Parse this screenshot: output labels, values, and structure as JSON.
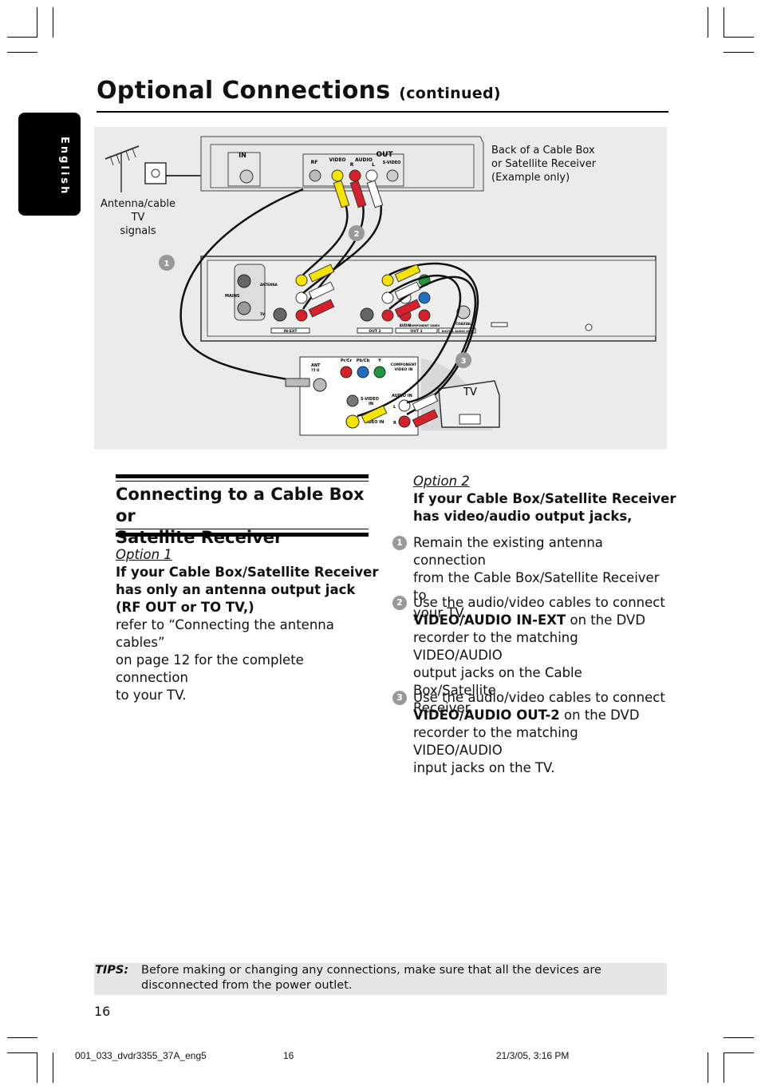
{
  "header": {
    "title": "Optional Connections",
    "title_suffix": "(continued)",
    "language_tab": "English"
  },
  "diagram": {
    "cable_box_label": [
      "Back of a Cable Box",
      "or Satellite Receiver",
      "(Example only)"
    ],
    "antenna_label": [
      "Antenna/cable TV",
      "signals"
    ],
    "cable_box_jacks": {
      "in": "IN",
      "out": "OUT",
      "rf": "RF",
      "video": "VIDEO",
      "audio": "AUDIO",
      "r": "R",
      "l": "L",
      "svideo": "S-VIDEO"
    },
    "recorder_labels": {
      "mains": "MAINS",
      "antenna": "ANTENNA",
      "tv": "TV",
      "in_ext": "IN-EXT",
      "out2": "OUT 2",
      "out1": "OUT 1",
      "audio": "AUDIO",
      "component": "COMPONENT VIDEO",
      "coaxial": "COAXIAL",
      "digital": "DIGITAL AUDIO OUT"
    },
    "tv_jacks": {
      "ant": "ANT",
      "ant_sub": "75 Ω",
      "pr": "Pr/Cr",
      "pb": "Pb/Cb",
      "y": "Y",
      "component": "COMPONENT",
      "component2": "VIDEO IN",
      "svideo": "S-VIDEO",
      "svideo2": "IN",
      "audio_in": "AUDIO IN",
      "l": "L",
      "r": "R",
      "video_in": "VIDEO IN"
    },
    "tv_label": "TV",
    "step_markers": [
      "1",
      "2",
      "3"
    ],
    "colors": {
      "video": "#f5e400",
      "audio_r": "#d8202a",
      "audio_l": "#ffffff",
      "y": "#1e9a3c",
      "pb": "#1f6fc0",
      "pr": "#d8202a"
    }
  },
  "section": {
    "title_line1": "Connecting to a Cable Box or",
    "title_line2": "Satellite Receiver",
    "option1": {
      "label": "Option 1",
      "heading": [
        "If your Cable Box/Satellite Receiver",
        "has only an antenna output jack",
        "(RF OUT or TO TV,)"
      ],
      "body": [
        "refer to “Connecting the antenna cables”",
        "on page 12 for the complete connection",
        "to your TV."
      ]
    },
    "option2": {
      "label": "Option 2",
      "heading": [
        "If your Cable Box/Satellite Receiver",
        "has video/audio output jacks,"
      ]
    },
    "steps": [
      {
        "num": "1",
        "lines": [
          "Remain the existing antenna connection",
          "from the Cable Box/Satellite Receiver to",
          "your TV."
        ]
      },
      {
        "num": "2",
        "pre": "Use the audio/video cables to connect",
        "bold": "VIDEO/AUDIO IN-EXT",
        "post": " on the DVD",
        "lines": [
          "recorder to the matching VIDEO/AUDIO",
          "output jacks on the Cable Box/Satellite",
          "Receiver."
        ]
      },
      {
        "num": "3",
        "pre": "Use the audio/video cables to connect",
        "bold": "VIDEO/AUDIO OUT-2",
        "post": " on the DVD",
        "lines": [
          "recorder to the matching VIDEO/AUDIO",
          "input jacks on the TV."
        ]
      }
    ]
  },
  "tips": {
    "label": "TIPS:",
    "text": "Before making or changing any connections, make sure that all the devices are disconnected from the power outlet."
  },
  "page_number": "16",
  "footer": {
    "file": "001_033_dvdr3355_37A_eng5",
    "page": "16",
    "date": "21/3/05, 3:16 PM"
  }
}
